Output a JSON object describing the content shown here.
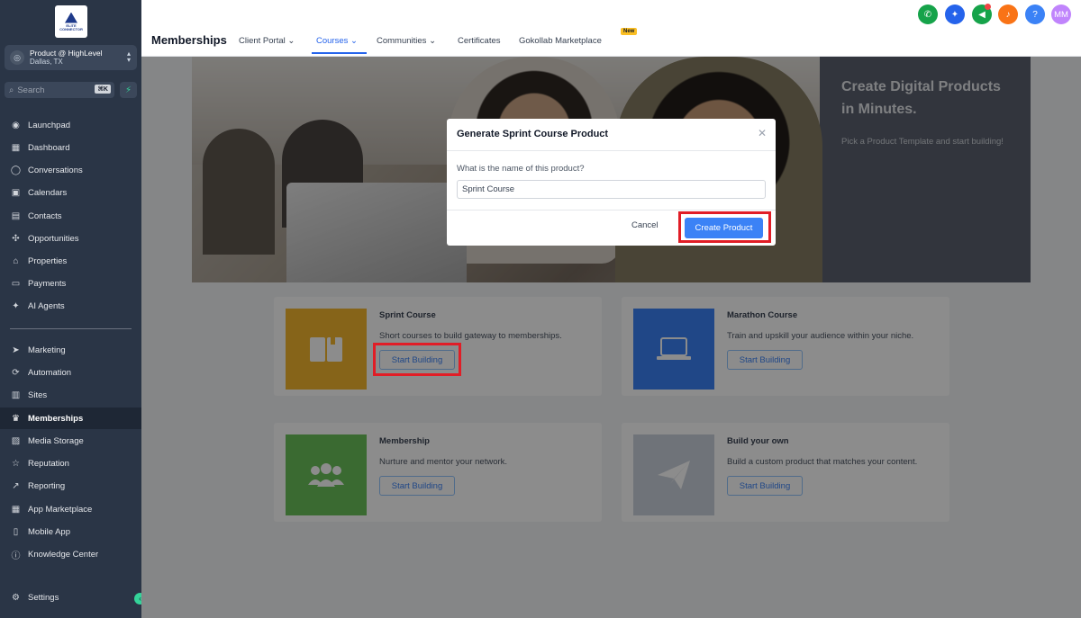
{
  "sidebar": {
    "logo": {
      "line1": "ELITE",
      "line2": "CONNECTOR"
    },
    "account": {
      "name": "Product @ HighLevel",
      "location": "Dallas, TX"
    },
    "search": {
      "placeholder": "Search",
      "shortcut": "⌘K"
    },
    "items": [
      {
        "label": "Launchpad",
        "icon": "launchpad-icon"
      },
      {
        "label": "Dashboard",
        "icon": "dashboard-icon"
      },
      {
        "label": "Conversations",
        "icon": "chat-icon"
      },
      {
        "label": "Calendars",
        "icon": "calendar-icon"
      },
      {
        "label": "Contacts",
        "icon": "contacts-icon"
      },
      {
        "label": "Opportunities",
        "icon": "opportunities-icon"
      },
      {
        "label": "Properties",
        "icon": "home-icon"
      },
      {
        "label": "Payments",
        "icon": "payments-icon"
      },
      {
        "label": "AI Agents",
        "icon": "sparkle-icon"
      },
      {
        "label": "Marketing",
        "icon": "send-icon"
      },
      {
        "label": "Automation",
        "icon": "automation-icon"
      },
      {
        "label": "Sites",
        "icon": "sites-icon"
      },
      {
        "label": "Memberships",
        "icon": "award-icon"
      },
      {
        "label": "Media Storage",
        "icon": "image-icon"
      },
      {
        "label": "Reputation",
        "icon": "star-icon"
      },
      {
        "label": "Reporting",
        "icon": "trend-icon"
      },
      {
        "label": "App Marketplace",
        "icon": "grid-icon"
      },
      {
        "label": "Mobile App",
        "icon": "phone-icon"
      },
      {
        "label": "Knowledge Center",
        "icon": "info-icon"
      },
      {
        "label": "Settings",
        "icon": "gear-icon"
      }
    ]
  },
  "header": {
    "title": "Memberships",
    "tabs": [
      {
        "label": "Client Portal",
        "has_dropdown": true
      },
      {
        "label": "Courses",
        "has_dropdown": true,
        "active": true
      },
      {
        "label": "Communities",
        "has_dropdown": true
      },
      {
        "label": "Certificates"
      },
      {
        "label": "Gokollab Marketplace",
        "badge": "New"
      }
    ],
    "user_initials": "MM",
    "help_label": "?"
  },
  "hero": {
    "title": "Create Digital Products in Minutes.",
    "subtitle": "Pick a Product Template and start building!"
  },
  "cards": [
    {
      "title": "Sprint Course",
      "description": "Short courses to build gateway to memberships.",
      "button": "Start Building",
      "color": "#f5b62e",
      "icon": "book-icon"
    },
    {
      "title": "Marathon Course",
      "description": "Train and upskill your audience within your niche.",
      "button": "Start Building",
      "color": "#3b82f6",
      "icon": "laptop-icon"
    },
    {
      "title": "Membership",
      "description": "Nurture and mentor your network.",
      "button": "Start Building",
      "color": "#6ac259",
      "icon": "users-icon"
    },
    {
      "title": "Build your own",
      "description": "Build a custom product that matches your content.",
      "button": "Start Building",
      "color": "#cbd2dc",
      "icon": "paper-plane-icon"
    }
  ],
  "modal": {
    "title": "Generate Sprint Course Product",
    "label": "What is the name of this product?",
    "input_value": "Sprint Course",
    "cancel": "Cancel",
    "create": "Create Product",
    "close_glyph": "✕"
  },
  "colors": {
    "accent": "#3b82f6",
    "highlight": "#e11d26",
    "sidebar": "#2a3546"
  }
}
